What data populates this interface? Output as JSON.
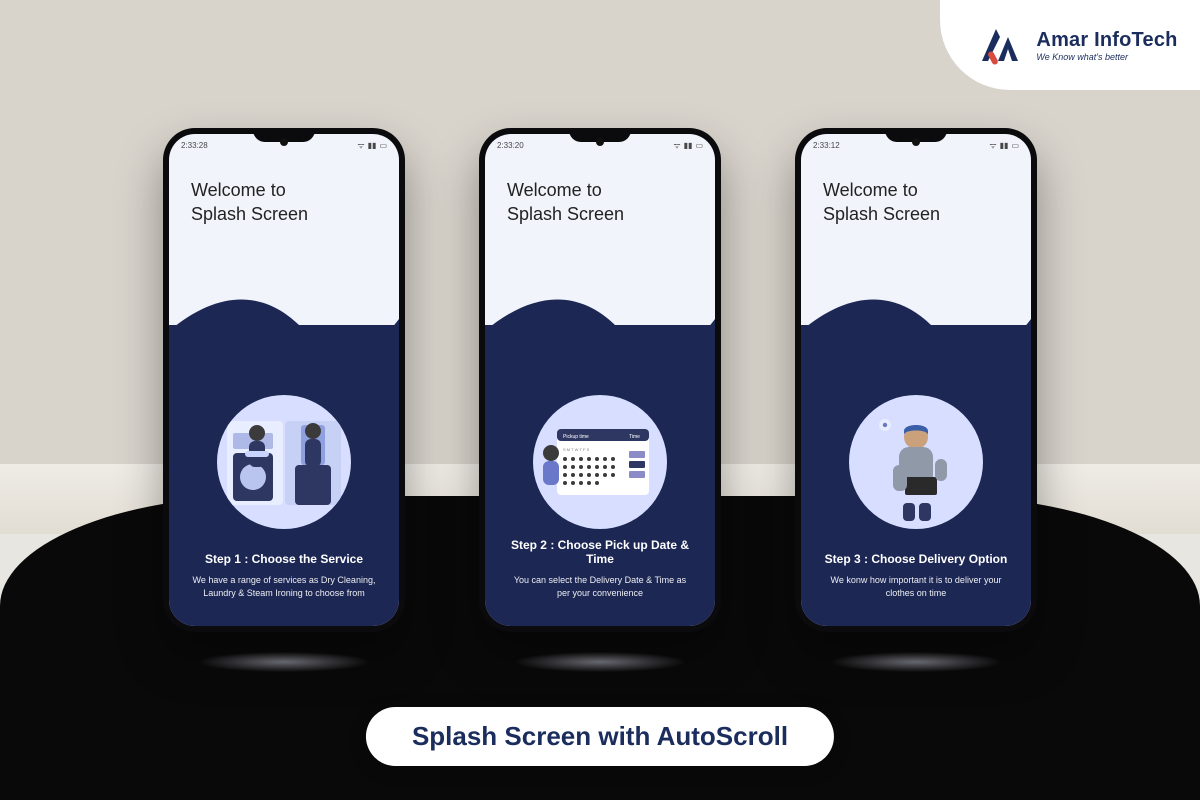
{
  "brand": {
    "name": "Amar InfoTech",
    "tagline": "We Know what's better",
    "colors": {
      "navy": "#1b2d5d",
      "deep_navy": "#1c2754",
      "lilac": "#8b8bc7",
      "accent_red": "#d94b3f"
    }
  },
  "caption": "Splash Screen with AutoScroll",
  "phones": [
    {
      "status_time": "2:33:28",
      "welcome_line1": "Welcome to",
      "welcome_line2": "Splash Screen",
      "illustration": "laundry-service-illustration",
      "step_title": "Step 1 : Choose the Service",
      "step_desc": "We have a range of services as Dry Cleaning, Laundry & Steam Ironing to choose from"
    },
    {
      "status_time": "2:33:20",
      "welcome_line1": "Welcome to",
      "welcome_line2": "Splash Screen",
      "illustration": "calendar-pickup-illustration",
      "step_title": "Step 2 : Choose Pick up Date & Time",
      "step_desc": "You can select the Delivery Date & Time as per your convenience"
    },
    {
      "status_time": "2:33:12",
      "welcome_line1": "Welcome to",
      "welcome_line2": "Splash Screen",
      "illustration": "delivery-person-illustration",
      "step_title": "Step 3 : Choose Delivery Option",
      "step_desc": "We konw how important it is to deliver your clothes on time"
    }
  ]
}
